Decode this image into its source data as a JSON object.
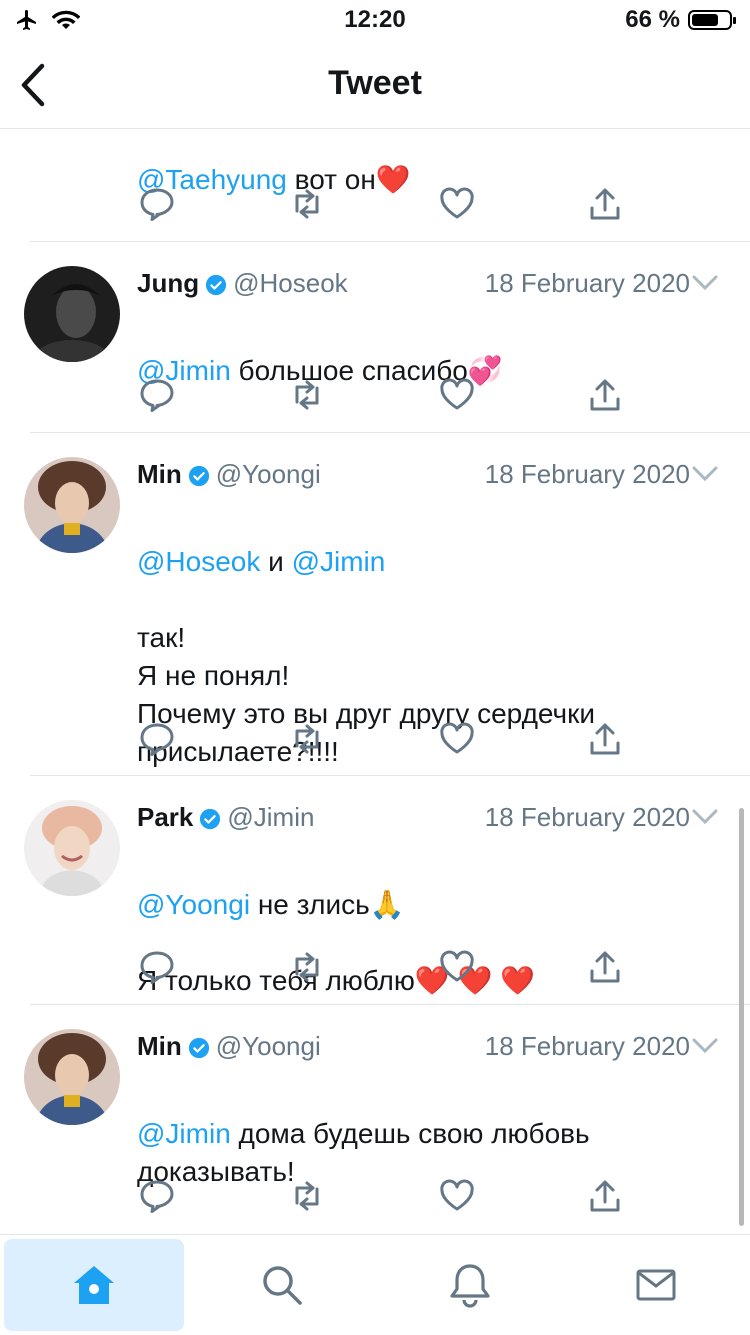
{
  "status_bar": {
    "time": "12:20",
    "battery": "66 %"
  },
  "header": {
    "title": "Tweet"
  },
  "colors": {
    "accent": "#1da1f2",
    "text": "#14171a",
    "muted": "#657786",
    "divider": "#e1e8ed",
    "heart": "#e0245e"
  },
  "tweets": [
    {
      "partial": true,
      "body_mention": "@Taehyung",
      "body_text": " вот он",
      "body_emoji": "❤️"
    },
    {
      "name": "Jung",
      "handle": "@Hoseok",
      "date": "18 February 2020",
      "body_mention": "@Jimin",
      "body_text": " большое спасибо",
      "body_emoji": "💞"
    },
    {
      "name": "Min",
      "handle": "@Yoongi",
      "date": "18 February 2020",
      "body_mention": "@Hoseok",
      "body_mid": " и ",
      "body_mention2": "@Jimin",
      "body_text": "так!\nЯ не понял!\nПочему это вы друг другу сердечки\nприсылаете?!!!!"
    },
    {
      "name": "Park",
      "handle": "@Jimin",
      "date": "18 February 2020",
      "body_mention": "@Yoongi",
      "body_text": " не злись",
      "body_emoji": "🙏",
      "body_line2": "Я только тебя люблю",
      "body_line2_emoji": "❤️ ❤️ ❤️"
    },
    {
      "name": "Min",
      "handle": "@Yoongi",
      "date": "18 February 2020",
      "body_mention": "@Jimin",
      "body_text": " дома будешь свою любовь\nдоказывать!"
    }
  ],
  "tabbar": {
    "items": [
      "home-icon",
      "search-icon",
      "bell-icon",
      "mail-icon"
    ],
    "active": "home-icon"
  }
}
